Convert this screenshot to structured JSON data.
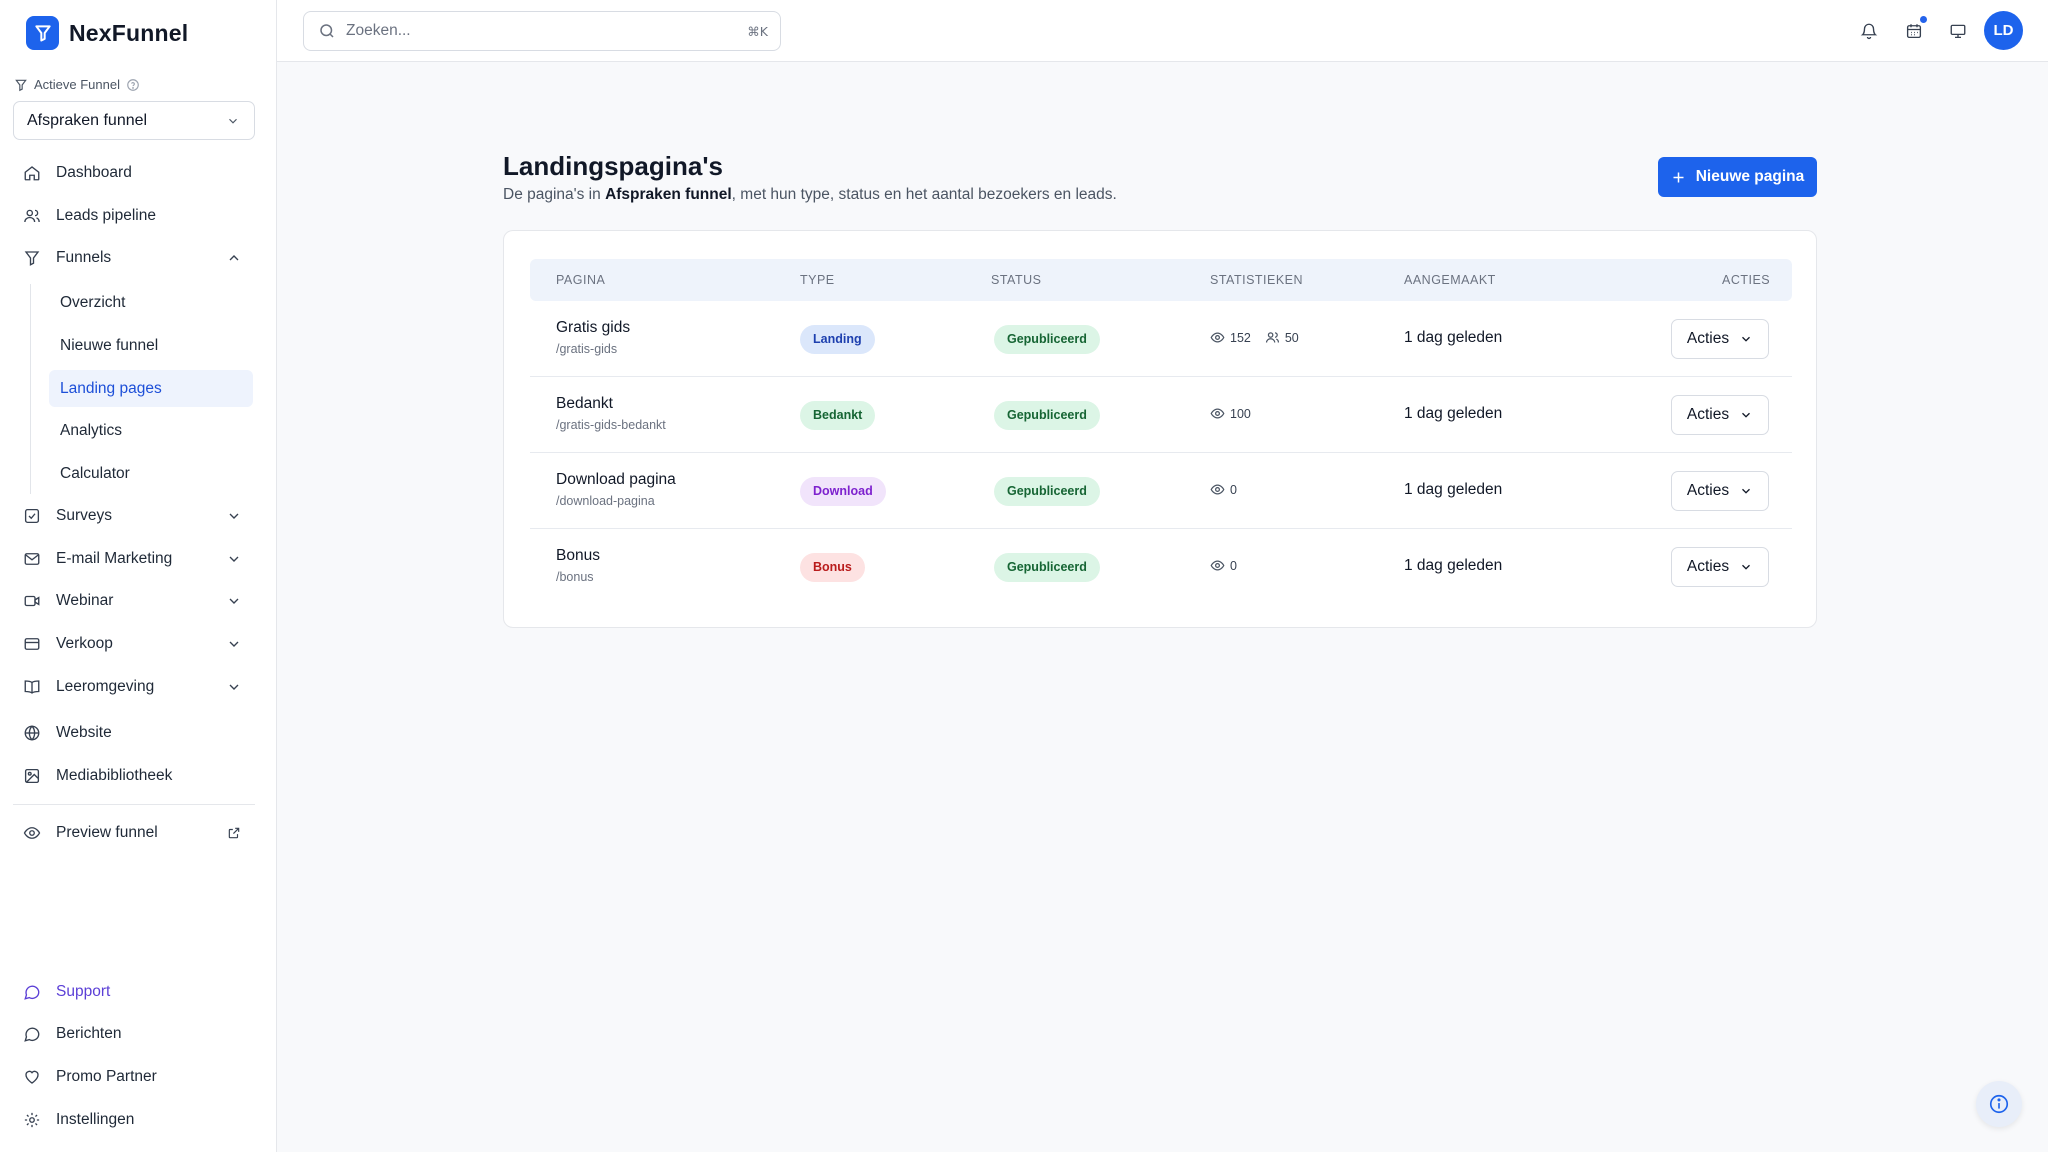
{
  "app": {
    "name": "NexFunnel"
  },
  "sidebar": {
    "active_funnel_label": "Actieve Funnel",
    "funnel_select_value": "Afspraken funnel",
    "nav": {
      "dashboard": "Dashboard",
      "leads": "Leads pipeline",
      "funnels": "Funnels",
      "surveys": "Surveys",
      "email": "E-mail Marketing",
      "webinar": "Webinar",
      "verkoop": "Verkoop",
      "leeromgeving": "Leeromgeving",
      "website": "Website",
      "media": "Mediabibliotheek",
      "preview": "Preview funnel"
    },
    "funnel_sub": {
      "overzicht": "Overzicht",
      "nieuwe": "Nieuwe funnel",
      "landing": "Landing pages",
      "analytics": "Analytics",
      "calculator": "Calculator"
    },
    "bottom": {
      "support": "Support",
      "berichten": "Berichten",
      "promo": "Promo Partner",
      "instellingen": "Instellingen"
    }
  },
  "topbar": {
    "search_placeholder": "Zoeken...",
    "search_shortcut": "⌘K",
    "avatar_initials": "LD"
  },
  "main": {
    "title": "Landingspagina's",
    "subtitle_prefix": "De pagina's in ",
    "subtitle_funnel": "Afspraken funnel",
    "subtitle_suffix": ", met hun type, status en het aantal bezoekers en leads.",
    "new_button": "Nieuwe pagina",
    "columns": {
      "pagina": "PAGINA",
      "type": "TYPE",
      "status": "STATUS",
      "stats": "STATISTIEKEN",
      "created": "AANGEMAAKT",
      "actions": "ACTIES"
    },
    "rows": [
      {
        "name": "Gratis gids",
        "slug": "/gratis-gids",
        "type": "Landing",
        "status": "Gepubliceerd",
        "views": "152",
        "leads": "50",
        "created": "1 dag geleden",
        "action": "Acties"
      },
      {
        "name": "Bedankt",
        "slug": "/gratis-gids-bedankt",
        "type": "Bedankt",
        "status": "Gepubliceerd",
        "views": "100",
        "created": "1 dag geleden",
        "action": "Acties"
      },
      {
        "name": "Download pagina",
        "slug": "/download-pagina",
        "type": "Download",
        "status": "Gepubliceerd",
        "views": "0",
        "created": "1 dag geleden",
        "action": "Acties"
      },
      {
        "name": "Bonus",
        "slug": "/bonus",
        "type": "Bonus",
        "status": "Gepubliceerd",
        "views": "0",
        "created": "1 dag geleden",
        "action": "Acties"
      }
    ]
  },
  "colors": {
    "primary": "#1d63ec",
    "badge_landing_bg": "#dbe7fb",
    "badge_landing_fg": "#1e40af",
    "badge_bedankt_bg": "#dcf5e6",
    "badge_bedankt_fg": "#166534",
    "badge_download_bg": "#f1e4fb",
    "badge_download_fg": "#7e22ce",
    "badge_bonus_bg": "#fde2e2",
    "badge_bonus_fg": "#b91c1c",
    "badge_status_bg": "#dcf5e6",
    "badge_status_fg": "#166534"
  }
}
